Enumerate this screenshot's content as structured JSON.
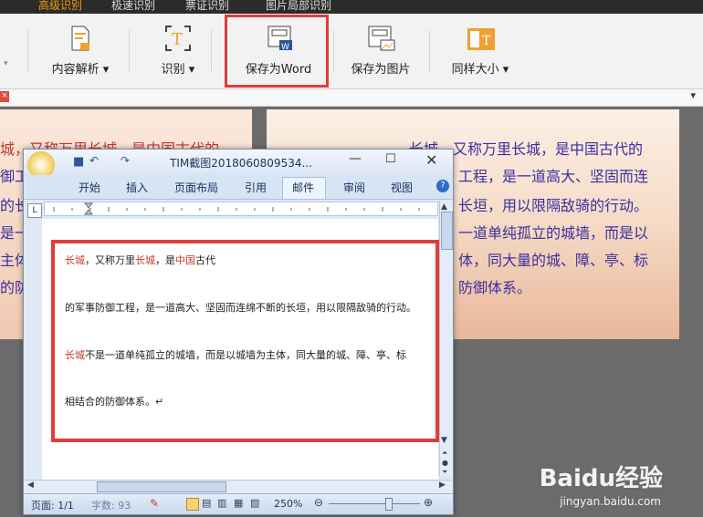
{
  "top_tabs": [
    "高级识别",
    "极速识别",
    "票证识别",
    "图片局部识别"
  ],
  "ribbon": {
    "content_parse": "内容解析",
    "recognize": "识别",
    "save_word": "保存为Word",
    "save_image": "保存为图片",
    "same_size": "同样大小"
  },
  "left_page": {
    "line1": "城，又称万里长城，是中国古代的",
    "line2": "御工",
    "line3": "的长",
    "line4": "是一",
    "line5": "主体",
    "line6": "的防"
  },
  "right_page": {
    "line1": "长城，又称万里长城，是中国古代的",
    "line2": "工程，是一道高大、坚固而连",
    "line3": "长垣，用以限隔敌骑的行动。",
    "line4": "一道单纯孤立的城墙，而是以",
    "line5": "体，同大量的城、障、亭、标",
    "line6": "防御体系。"
  },
  "word": {
    "title": "TIM截图2018060809534...",
    "tabs": [
      "开始",
      "插入",
      "页面布局",
      "引用",
      "邮件",
      "审阅",
      "视图"
    ],
    "active_tab": "邮件",
    "doc_lines": [
      {
        "red1": "长城",
        "t1": "，又称万里",
        "red2": "长城",
        "t2": "，是",
        "red3": "中国",
        "t3": "古代"
      },
      {
        "t1": "的军事防御工程，是一道高大、坚固而连绵不断的长垣，用以限隔敌骑的行动。"
      },
      {
        "red1": "长城",
        "t1": "不是一道单纯孤立的城墙，而是以城墙为主体，同大量的城、障、亭、标"
      },
      {
        "t1": "相结合的防御体系。↵"
      }
    ],
    "status": {
      "page": "页面: 1/1",
      "words": "字数: 93",
      "zoom": "250%"
    }
  },
  "watermark": {
    "brand": "Baidu经验",
    "url": "jingyan.baidu.com"
  }
}
